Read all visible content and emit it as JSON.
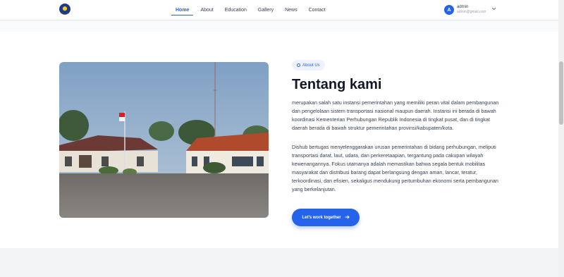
{
  "nav": {
    "items": [
      "Home",
      "About",
      "Education",
      "Gallery",
      "News",
      "Contact"
    ]
  },
  "user": {
    "initial": "A",
    "name": "admin",
    "email": "admin@gmail.com"
  },
  "about": {
    "badge": "About Us",
    "title": "Tentang kami",
    "paragraph1": "merupakan salah satu instansi pemerintahan yang memiliki peran vital dalam pembangunan dan pengelolaan sistem transportasi nasional maupun daerah. Instansi ini berada di bawah koordinasi Kementerian Perhubungan Republik Indonesia di tingkat pusat, dan di tingkat daerah berada di bawah struktur pemerintahan provinsi/kabupaten/kota.",
    "paragraph2": "Dishub bertugas menyelenggarakan urusan pemerintahan di bidang perhubungan, meliputi transportasi darat, laut, udara, dan perkeretaapian, tergantung pada cakupan wilayah kewenangannya. Fokus utamanya adalah memastikan bahwa segala bentuk mobilitas masyarakat dan distribusi barang dapat berlangsung dengan aman, lancar, teratur, terkoordinasi, dan efisien, sekaligus mendukung pertumbuhan ekonomi serta pembangunan yang berkelanjutan.",
    "cta": "Let's work together"
  },
  "colors": {
    "accent": "#2563eb"
  },
  "icons": [
    "logo-icon",
    "chevron-down-icon",
    "info-icon",
    "arrow-right-icon"
  ]
}
